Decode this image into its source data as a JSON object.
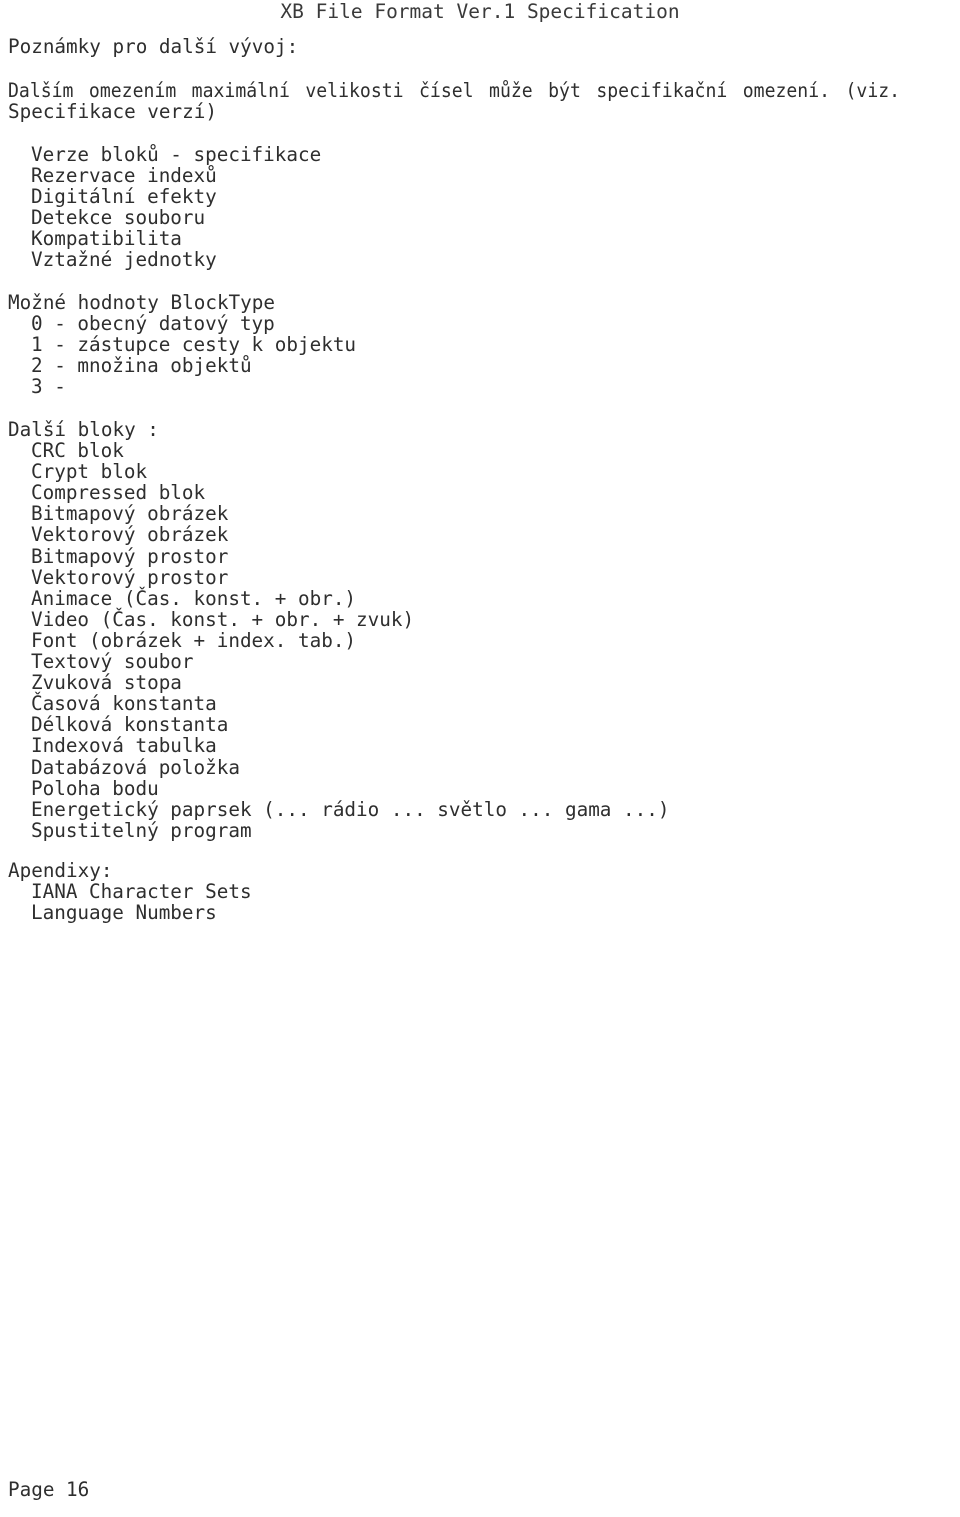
{
  "document": {
    "header_title": "XB File Format Ver.1 Specification",
    "footer": "Page 16"
  },
  "sections": {
    "notes_heading": "Poznámky pro další vývoj:",
    "paragraph": {
      "line1": "Dalším  omezením  maximální velikosti čísel může být specifikační omezení. (viz.",
      "line2": "Specifikace verzí)"
    },
    "topics": [
      "Verze bloků - specifikace",
      "Rezervace indexů",
      "Digitální efekty",
      "Detekce souboru",
      "Kompatibilita",
      "Vztažné jednotky"
    ],
    "blocktype_heading": "Možné hodnoty BlockType",
    "blocktype_values": [
      "0 - obecný datový typ",
      "1 - zástupce cesty k objektu",
      "2 - množina objektů",
      "3 -"
    ],
    "other_blocks_heading": "Další bloky :",
    "other_blocks": [
      "CRC blok",
      "Crypt blok",
      "Compressed blok",
      "Bitmapový obrázek",
      "Vektorový obrázek",
      "Bitmapový prostor",
      "Vektorový prostor",
      "Animace (Čas. konst. + obr.)",
      "Video (Čas. konst. + obr. + zvuk)",
      "Font (obrázek + index. tab.)",
      "Textový soubor",
      "Zvuková stopa",
      "Časová konstanta",
      "Délková konstanta",
      "Indexová tabulka",
      "Databázová položka",
      "Poloha bodu",
      "Energetický paprsek (... rádio ... světlo ... gama ...)",
      "Spustitelný program"
    ],
    "appendix_heading": "Apendixy:",
    "appendix_items": [
      "IANA Character Sets",
      "Language Numbers"
    ]
  },
  "colors": {
    "text": "#2e2e2e",
    "background": "#ffffff"
  }
}
